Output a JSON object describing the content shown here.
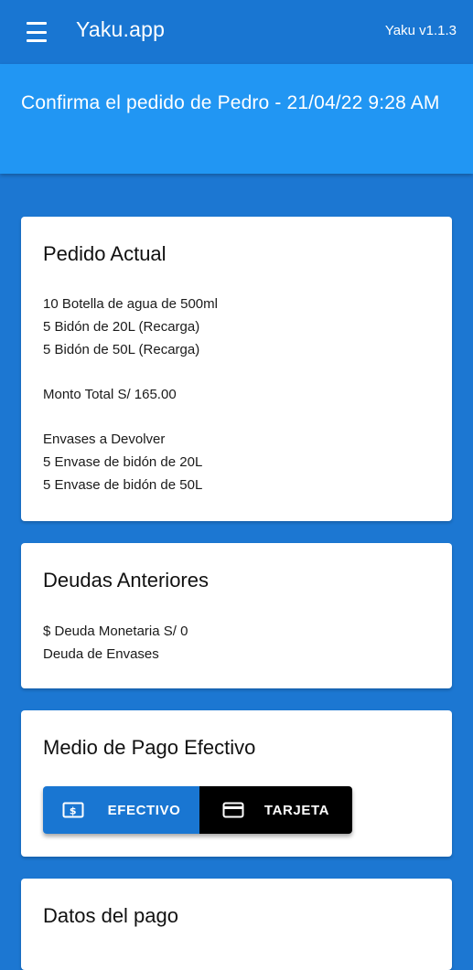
{
  "appbar": {
    "title": "Yaku.app",
    "version": "Yaku v1.1.3"
  },
  "banner": {
    "title": "Confirma el pedido de Pedro - 21/04/22 9:28 AM"
  },
  "pedido_actual": {
    "title": "Pedido Actual",
    "items": [
      "10 Botella de agua de 500ml",
      "5 Bidón de 20L (Recarga)",
      "5 Bidón de 50L (Recarga)"
    ],
    "total": "Monto Total S/ 165.00",
    "envases_heading": "Envases a Devolver",
    "envases": [
      "5 Envase de bidón de 20L",
      "5 Envase de bidón de 50L"
    ]
  },
  "deudas": {
    "title": "Deudas Anteriores",
    "monetaria": "$ Deuda Monetaria S/ 0",
    "envases": "Deuda de Envases"
  },
  "medio_pago": {
    "title": "Medio de Pago Efectivo",
    "options": [
      {
        "label": "EFECTIVO",
        "icon": "cash-icon",
        "selected": true
      },
      {
        "label": "TARJETA",
        "icon": "credit-card-icon",
        "selected": false
      }
    ]
  },
  "datos_pago": {
    "title": "Datos del pago"
  },
  "colors": {
    "appbar": "#1976d2",
    "banner": "#2196f3",
    "background": "#1c77d2",
    "selected_toggle": "#1976d2",
    "unselected_toggle": "#000000"
  }
}
